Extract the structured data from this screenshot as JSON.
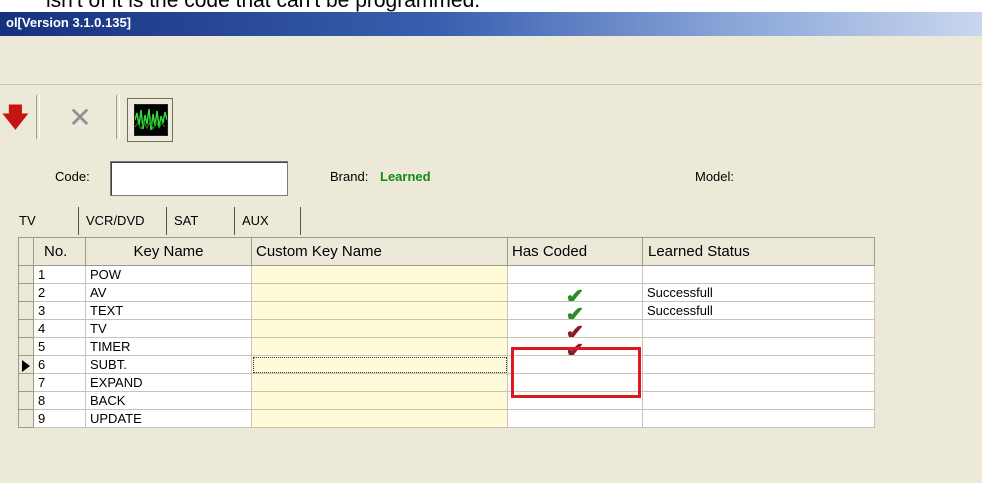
{
  "caption": "isn't of it is the code that can't be programmed.",
  "window": {
    "title": "ol[Version 3.1.0.135]"
  },
  "toolbar": {
    "down_icon": "arrow-down-icon",
    "cancel_icon": "close-icon",
    "scope_icon": "waveform-icon"
  },
  "codebar": {
    "code_label": "Code:",
    "code_value": "",
    "brand_label": "Brand:",
    "brand_value": "Learned",
    "model_label": "Model:"
  },
  "tabs": [
    "TV",
    "VCR/DVD",
    "SAT",
    "AUX"
  ],
  "colors": {
    "brand_value": "#138a13",
    "check_green": "#2e8b24",
    "check_maroon": "#8a1c2c",
    "highlight_box": "#e0161e",
    "custom_col_bg": "#fffbd9"
  },
  "grid": {
    "headers": [
      "No.",
      "Key Name",
      "Custom Key Name",
      "Has Coded",
      "Learned Status"
    ],
    "rows": [
      {
        "no": "1",
        "key": "POW",
        "custom": "",
        "coded": "",
        "status": ""
      },
      {
        "no": "2",
        "key": "AV",
        "custom": "",
        "coded": "green",
        "status": "Successfull"
      },
      {
        "no": "3",
        "key": "TEXT",
        "custom": "",
        "coded": "green",
        "status": "Successfull"
      },
      {
        "no": "4",
        "key": "TV",
        "custom": "",
        "coded": "maroon",
        "status": ""
      },
      {
        "no": "5",
        "key": "TIMER",
        "custom": "",
        "coded": "maroon",
        "status": ""
      },
      {
        "no": "6",
        "key": "SUBT.",
        "custom": "",
        "coded": "",
        "status": "",
        "current": true
      },
      {
        "no": "7",
        "key": "EXPAND",
        "custom": "",
        "coded": "",
        "status": ""
      },
      {
        "no": "8",
        "key": "BACK",
        "custom": "",
        "coded": "",
        "status": ""
      },
      {
        "no": "9",
        "key": "UPDATE",
        "custom": "",
        "coded": "",
        "status": ""
      }
    ]
  }
}
